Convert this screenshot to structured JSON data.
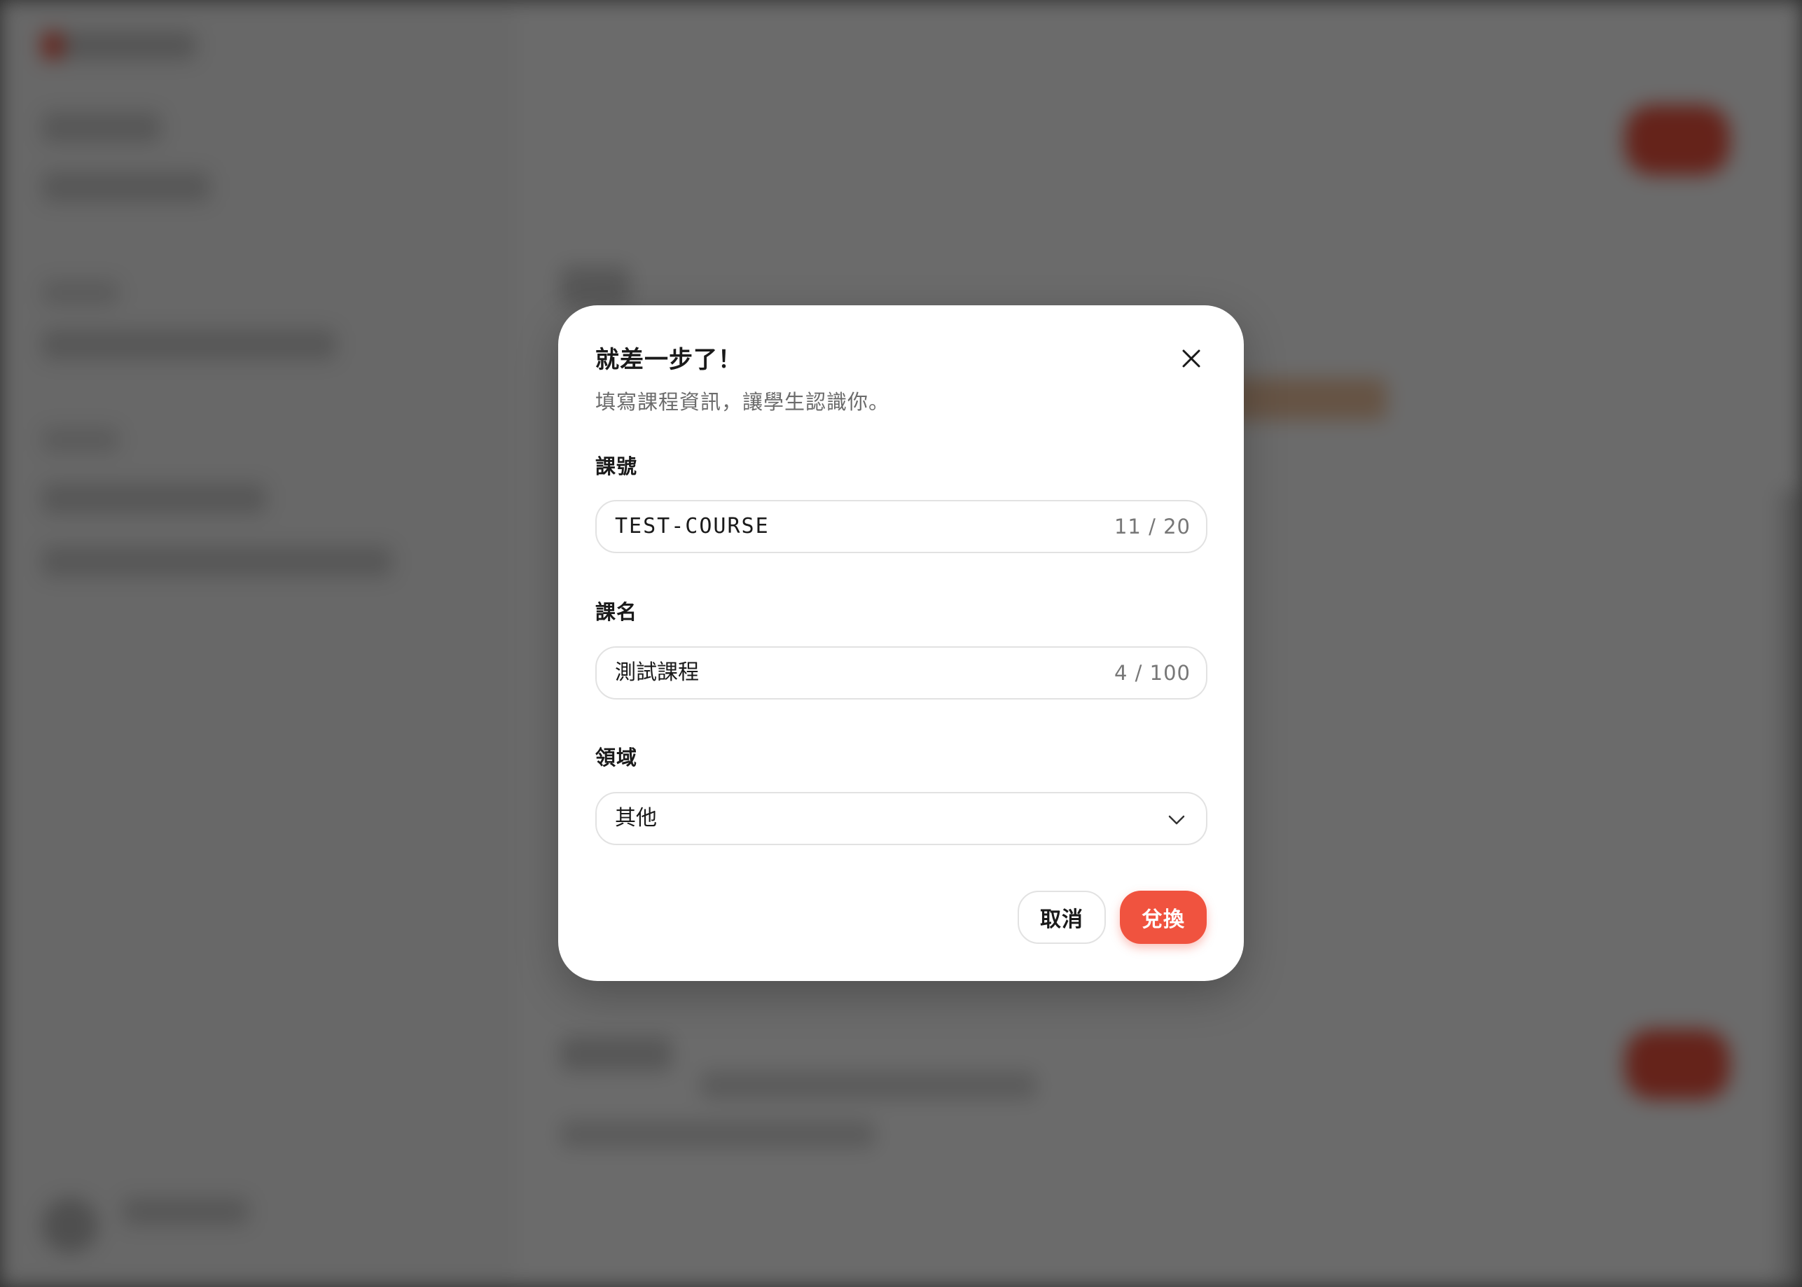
{
  "dialog": {
    "title": "就差一步了！",
    "subtitle": "填寫課程資訊，讓學生認識你。",
    "course_code": {
      "label": "課號",
      "value": "TEST-COURSE",
      "counter": "11 / 20"
    },
    "course_name": {
      "label": "課名",
      "value": "測試課程",
      "counter": "4 / 100"
    },
    "domain": {
      "label": "領域",
      "selected": "其他"
    },
    "cancel_label": "取消",
    "redeem_label": "兌換"
  },
  "colors": {
    "accent": "#f0533f",
    "overlay": "#6b6b6b"
  },
  "icons": {
    "close": "close-icon",
    "chevron": "chevron-down-icon"
  }
}
